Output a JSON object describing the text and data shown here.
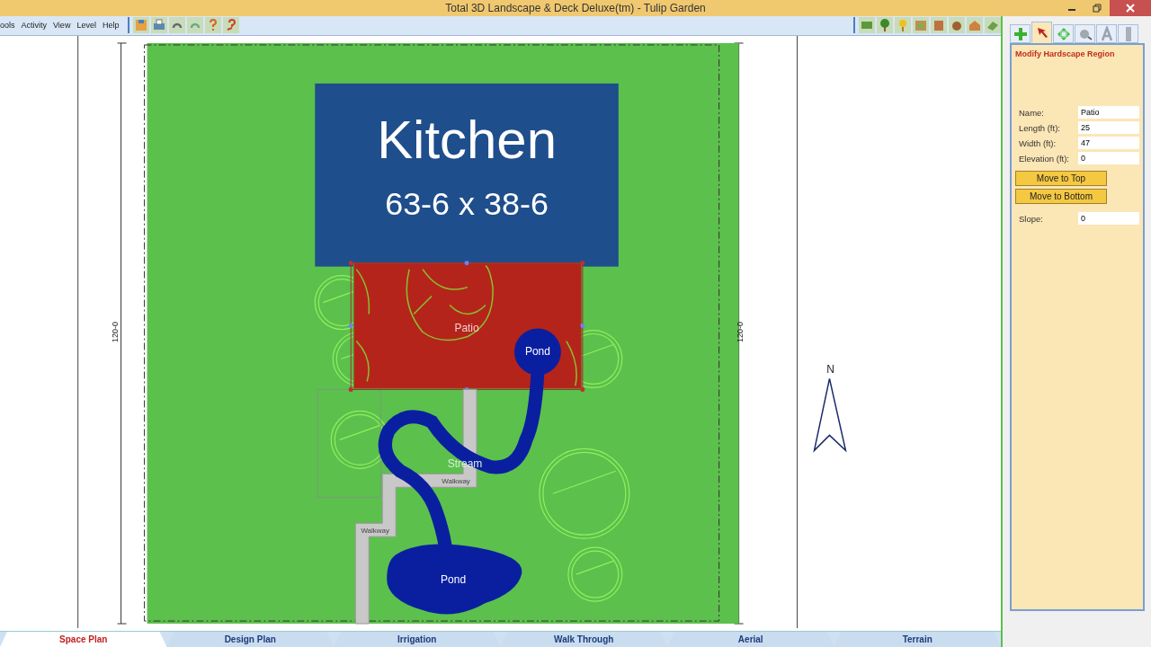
{
  "window": {
    "title": "Total 3D Landscape & Deck Deluxe(tm) - Tulip Garden"
  },
  "menu": [
    "ools",
    "Activity",
    "View",
    "Level",
    "Help"
  ],
  "tool_tabs": [
    {
      "kind": "add",
      "selected": false
    },
    {
      "kind": "select",
      "selected": true
    },
    {
      "kind": "move",
      "selected": false
    },
    {
      "kind": "measure",
      "selected": false
    },
    {
      "kind": "text",
      "selected": false
    },
    {
      "kind": "marker",
      "selected": false
    }
  ],
  "panel": {
    "heading": "Modify Hardscape Region",
    "fields": [
      {
        "label": "Name:",
        "value": "Patio"
      },
      {
        "label": "Length (ft):",
        "value": "25"
      },
      {
        "label": "Width (ft):",
        "value": "47"
      },
      {
        "label": "Elevation (ft):",
        "value": "0"
      }
    ],
    "buttons": [
      "Move to Top",
      "Move to Bottom"
    ],
    "slope": {
      "label": "Slope:",
      "value": "0"
    }
  },
  "plan": {
    "dimension_left": "120-0",
    "dimension_right": "120-0",
    "house": {
      "name": "Kitchen",
      "size": "63-6 x 38-6"
    },
    "patio": {
      "label": "Patio",
      "selected": true
    },
    "pond_small": {
      "label": "Pond"
    },
    "stream": {
      "label": "Stream"
    },
    "walkways": [
      {
        "label": "Walkway"
      },
      {
        "label": "Walkway"
      }
    ],
    "pond_large": {
      "label": "Pond"
    },
    "north": "N"
  },
  "tabs": [
    {
      "label": "Space Plan",
      "selected": true
    },
    {
      "label": "Design Plan",
      "selected": false
    },
    {
      "label": "Irrigation",
      "selected": false
    },
    {
      "label": "Walk Through",
      "selected": false
    },
    {
      "label": "Aerial",
      "selected": false
    },
    {
      "label": "Terrain",
      "selected": false
    }
  ]
}
